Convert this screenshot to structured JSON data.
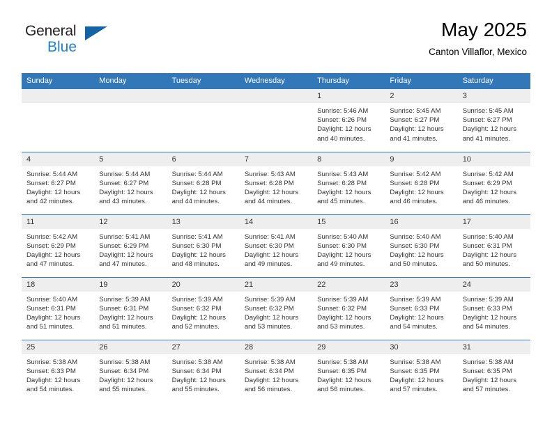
{
  "brand": {
    "line1": "General",
    "line2": "Blue",
    "flag_icon": "triangle-flag-icon",
    "accent_color": "#1f7fc4"
  },
  "header": {
    "title": "May 2025",
    "subtitle": "Canton Villaflor, Mexico"
  },
  "theme": {
    "header_bg": "#3277b8",
    "daynum_bg": "#eeeeee",
    "text": "#333333"
  },
  "calendar": {
    "weekday_headers": [
      "Sunday",
      "Monday",
      "Tuesday",
      "Wednesday",
      "Thursday",
      "Friday",
      "Saturday"
    ],
    "weeks": [
      [
        {
          "day": "",
          "empty": true
        },
        {
          "day": "",
          "empty": true
        },
        {
          "day": "",
          "empty": true
        },
        {
          "day": "",
          "empty": true
        },
        {
          "day": "1",
          "sunrise": "Sunrise: 5:46 AM",
          "sunset": "Sunset: 6:26 PM",
          "daylight1": "Daylight: 12 hours",
          "daylight2": "and 40 minutes."
        },
        {
          "day": "2",
          "sunrise": "Sunrise: 5:45 AM",
          "sunset": "Sunset: 6:27 PM",
          "daylight1": "Daylight: 12 hours",
          "daylight2": "and 41 minutes."
        },
        {
          "day": "3",
          "sunrise": "Sunrise: 5:45 AM",
          "sunset": "Sunset: 6:27 PM",
          "daylight1": "Daylight: 12 hours",
          "daylight2": "and 41 minutes."
        }
      ],
      [
        {
          "day": "4",
          "sunrise": "Sunrise: 5:44 AM",
          "sunset": "Sunset: 6:27 PM",
          "daylight1": "Daylight: 12 hours",
          "daylight2": "and 42 minutes."
        },
        {
          "day": "5",
          "sunrise": "Sunrise: 5:44 AM",
          "sunset": "Sunset: 6:27 PM",
          "daylight1": "Daylight: 12 hours",
          "daylight2": "and 43 minutes."
        },
        {
          "day": "6",
          "sunrise": "Sunrise: 5:44 AM",
          "sunset": "Sunset: 6:28 PM",
          "daylight1": "Daylight: 12 hours",
          "daylight2": "and 44 minutes."
        },
        {
          "day": "7",
          "sunrise": "Sunrise: 5:43 AM",
          "sunset": "Sunset: 6:28 PM",
          "daylight1": "Daylight: 12 hours",
          "daylight2": "and 44 minutes."
        },
        {
          "day": "8",
          "sunrise": "Sunrise: 5:43 AM",
          "sunset": "Sunset: 6:28 PM",
          "daylight1": "Daylight: 12 hours",
          "daylight2": "and 45 minutes."
        },
        {
          "day": "9",
          "sunrise": "Sunrise: 5:42 AM",
          "sunset": "Sunset: 6:28 PM",
          "daylight1": "Daylight: 12 hours",
          "daylight2": "and 46 minutes."
        },
        {
          "day": "10",
          "sunrise": "Sunrise: 5:42 AM",
          "sunset": "Sunset: 6:29 PM",
          "daylight1": "Daylight: 12 hours",
          "daylight2": "and 46 minutes."
        }
      ],
      [
        {
          "day": "11",
          "sunrise": "Sunrise: 5:42 AM",
          "sunset": "Sunset: 6:29 PM",
          "daylight1": "Daylight: 12 hours",
          "daylight2": "and 47 minutes."
        },
        {
          "day": "12",
          "sunrise": "Sunrise: 5:41 AM",
          "sunset": "Sunset: 6:29 PM",
          "daylight1": "Daylight: 12 hours",
          "daylight2": "and 47 minutes."
        },
        {
          "day": "13",
          "sunrise": "Sunrise: 5:41 AM",
          "sunset": "Sunset: 6:30 PM",
          "daylight1": "Daylight: 12 hours",
          "daylight2": "and 48 minutes."
        },
        {
          "day": "14",
          "sunrise": "Sunrise: 5:41 AM",
          "sunset": "Sunset: 6:30 PM",
          "daylight1": "Daylight: 12 hours",
          "daylight2": "and 49 minutes."
        },
        {
          "day": "15",
          "sunrise": "Sunrise: 5:40 AM",
          "sunset": "Sunset: 6:30 PM",
          "daylight1": "Daylight: 12 hours",
          "daylight2": "and 49 minutes."
        },
        {
          "day": "16",
          "sunrise": "Sunrise: 5:40 AM",
          "sunset": "Sunset: 6:30 PM",
          "daylight1": "Daylight: 12 hours",
          "daylight2": "and 50 minutes."
        },
        {
          "day": "17",
          "sunrise": "Sunrise: 5:40 AM",
          "sunset": "Sunset: 6:31 PM",
          "daylight1": "Daylight: 12 hours",
          "daylight2": "and 50 minutes."
        }
      ],
      [
        {
          "day": "18",
          "sunrise": "Sunrise: 5:40 AM",
          "sunset": "Sunset: 6:31 PM",
          "daylight1": "Daylight: 12 hours",
          "daylight2": "and 51 minutes."
        },
        {
          "day": "19",
          "sunrise": "Sunrise: 5:39 AM",
          "sunset": "Sunset: 6:31 PM",
          "daylight1": "Daylight: 12 hours",
          "daylight2": "and 51 minutes."
        },
        {
          "day": "20",
          "sunrise": "Sunrise: 5:39 AM",
          "sunset": "Sunset: 6:32 PM",
          "daylight1": "Daylight: 12 hours",
          "daylight2": "and 52 minutes."
        },
        {
          "day": "21",
          "sunrise": "Sunrise: 5:39 AM",
          "sunset": "Sunset: 6:32 PM",
          "daylight1": "Daylight: 12 hours",
          "daylight2": "and 53 minutes."
        },
        {
          "day": "22",
          "sunrise": "Sunrise: 5:39 AM",
          "sunset": "Sunset: 6:32 PM",
          "daylight1": "Daylight: 12 hours",
          "daylight2": "and 53 minutes."
        },
        {
          "day": "23",
          "sunrise": "Sunrise: 5:39 AM",
          "sunset": "Sunset: 6:33 PM",
          "daylight1": "Daylight: 12 hours",
          "daylight2": "and 54 minutes."
        },
        {
          "day": "24",
          "sunrise": "Sunrise: 5:39 AM",
          "sunset": "Sunset: 6:33 PM",
          "daylight1": "Daylight: 12 hours",
          "daylight2": "and 54 minutes."
        }
      ],
      [
        {
          "day": "25",
          "sunrise": "Sunrise: 5:38 AM",
          "sunset": "Sunset: 6:33 PM",
          "daylight1": "Daylight: 12 hours",
          "daylight2": "and 54 minutes."
        },
        {
          "day": "26",
          "sunrise": "Sunrise: 5:38 AM",
          "sunset": "Sunset: 6:34 PM",
          "daylight1": "Daylight: 12 hours",
          "daylight2": "and 55 minutes."
        },
        {
          "day": "27",
          "sunrise": "Sunrise: 5:38 AM",
          "sunset": "Sunset: 6:34 PM",
          "daylight1": "Daylight: 12 hours",
          "daylight2": "and 55 minutes."
        },
        {
          "day": "28",
          "sunrise": "Sunrise: 5:38 AM",
          "sunset": "Sunset: 6:34 PM",
          "daylight1": "Daylight: 12 hours",
          "daylight2": "and 56 minutes."
        },
        {
          "day": "29",
          "sunrise": "Sunrise: 5:38 AM",
          "sunset": "Sunset: 6:35 PM",
          "daylight1": "Daylight: 12 hours",
          "daylight2": "and 56 minutes."
        },
        {
          "day": "30",
          "sunrise": "Sunrise: 5:38 AM",
          "sunset": "Sunset: 6:35 PM",
          "daylight1": "Daylight: 12 hours",
          "daylight2": "and 57 minutes."
        },
        {
          "day": "31",
          "sunrise": "Sunrise: 5:38 AM",
          "sunset": "Sunset: 6:35 PM",
          "daylight1": "Daylight: 12 hours",
          "daylight2": "and 57 minutes."
        }
      ]
    ]
  }
}
